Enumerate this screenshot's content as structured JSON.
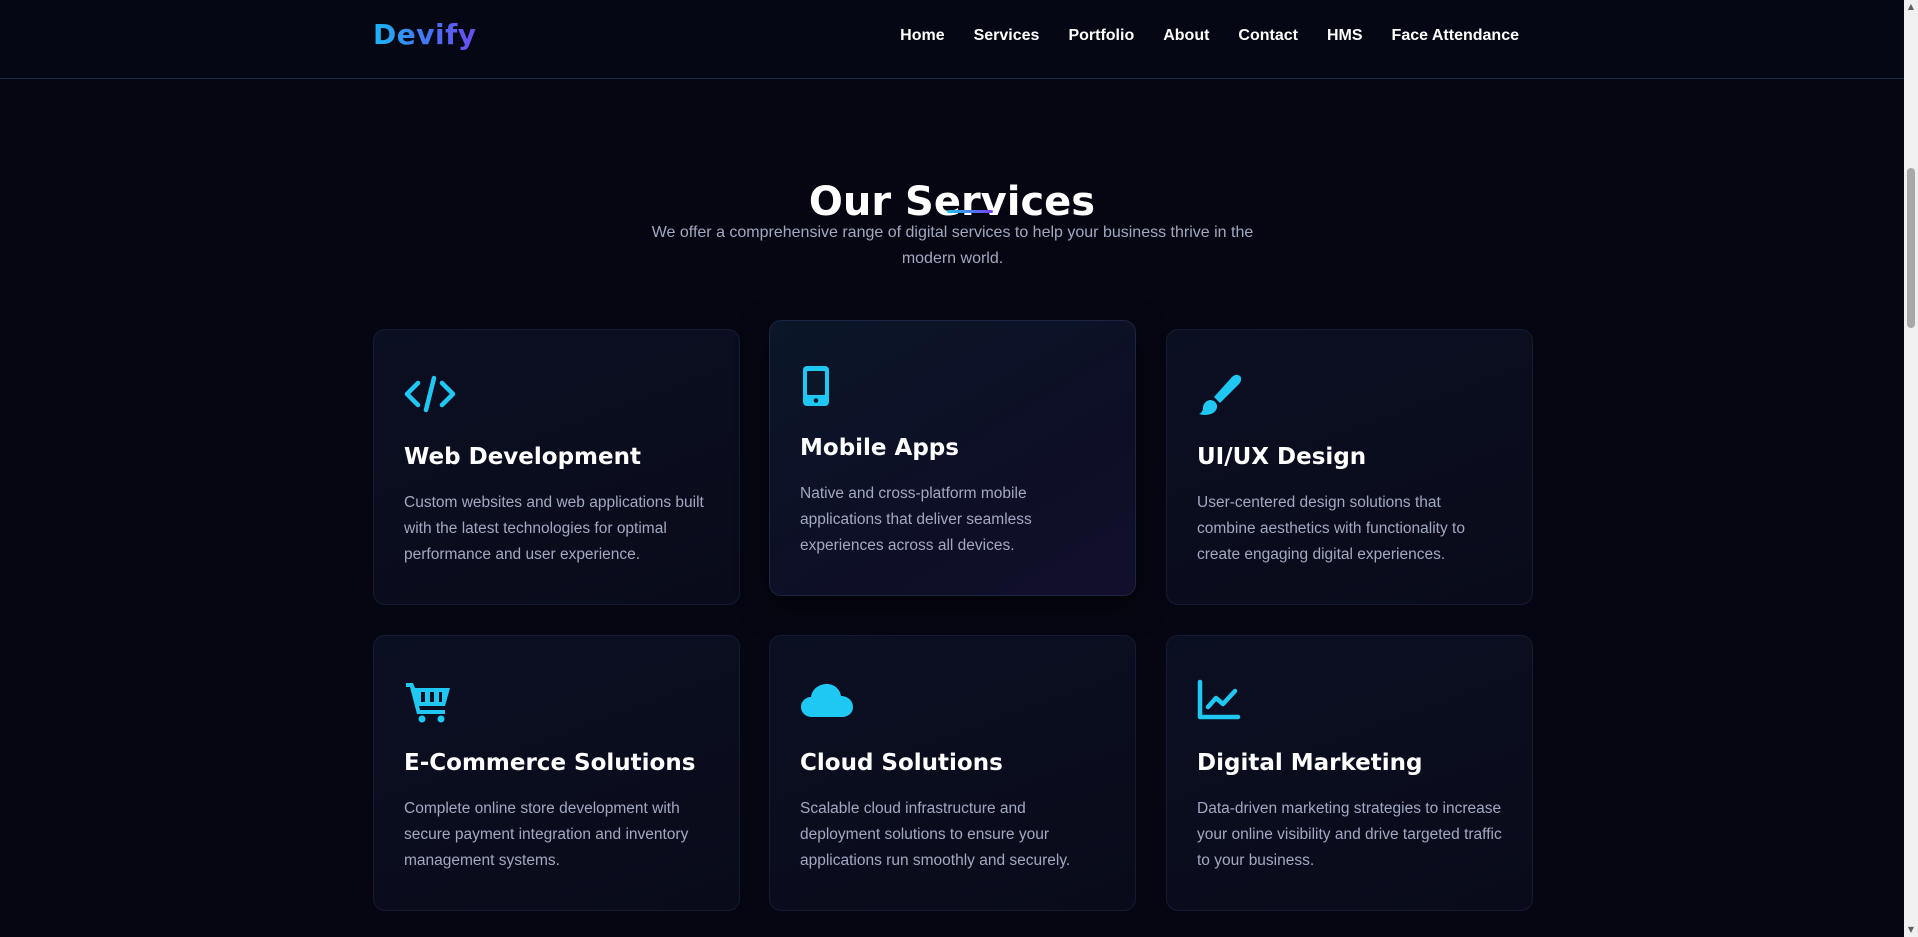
{
  "brand": {
    "name": "Devify"
  },
  "nav": {
    "items": [
      "Home",
      "Services",
      "Portfolio",
      "About",
      "Contact",
      "HMS",
      "Face Attendance"
    ]
  },
  "services": {
    "title": "Our Services",
    "subtitle": "We offer a comprehensive range of digital services to help your business thrive in the modern world.",
    "cards": [
      {
        "icon": "code-icon",
        "title": "Web Development",
        "description": "Custom websites and web applications built with the latest technologies for optimal performance and user experience."
      },
      {
        "icon": "mobile-phone-icon",
        "title": "Mobile Apps",
        "description": "Native and cross-platform mobile applications that deliver seamless experiences across all devices."
      },
      {
        "icon": "paint-brush-icon",
        "title": "UI/UX Design",
        "description": "User-centered design solutions that combine aesthetics with functionality to create engaging digital experiences."
      },
      {
        "icon": "shopping-cart-icon",
        "title": "E-Commerce Solutions",
        "description": "Complete online store development with secure payment integration and inventory management systems."
      },
      {
        "icon": "cloud-icon",
        "title": "Cloud Solutions",
        "description": "Scalable cloud infrastructure and deployment solutions to ensure your applications run smoothly and securely."
      },
      {
        "icon": "chart-line-icon",
        "title": "Digital Marketing",
        "description": "Data-driven marketing strategies to increase your online visibility and drive targeted traffic to your business."
      }
    ]
  },
  "colors": {
    "background": "#050611",
    "accent": "#1ec8f2",
    "accent_secondary": "#7b3cf0",
    "muted_text": "#a3a8c2"
  }
}
